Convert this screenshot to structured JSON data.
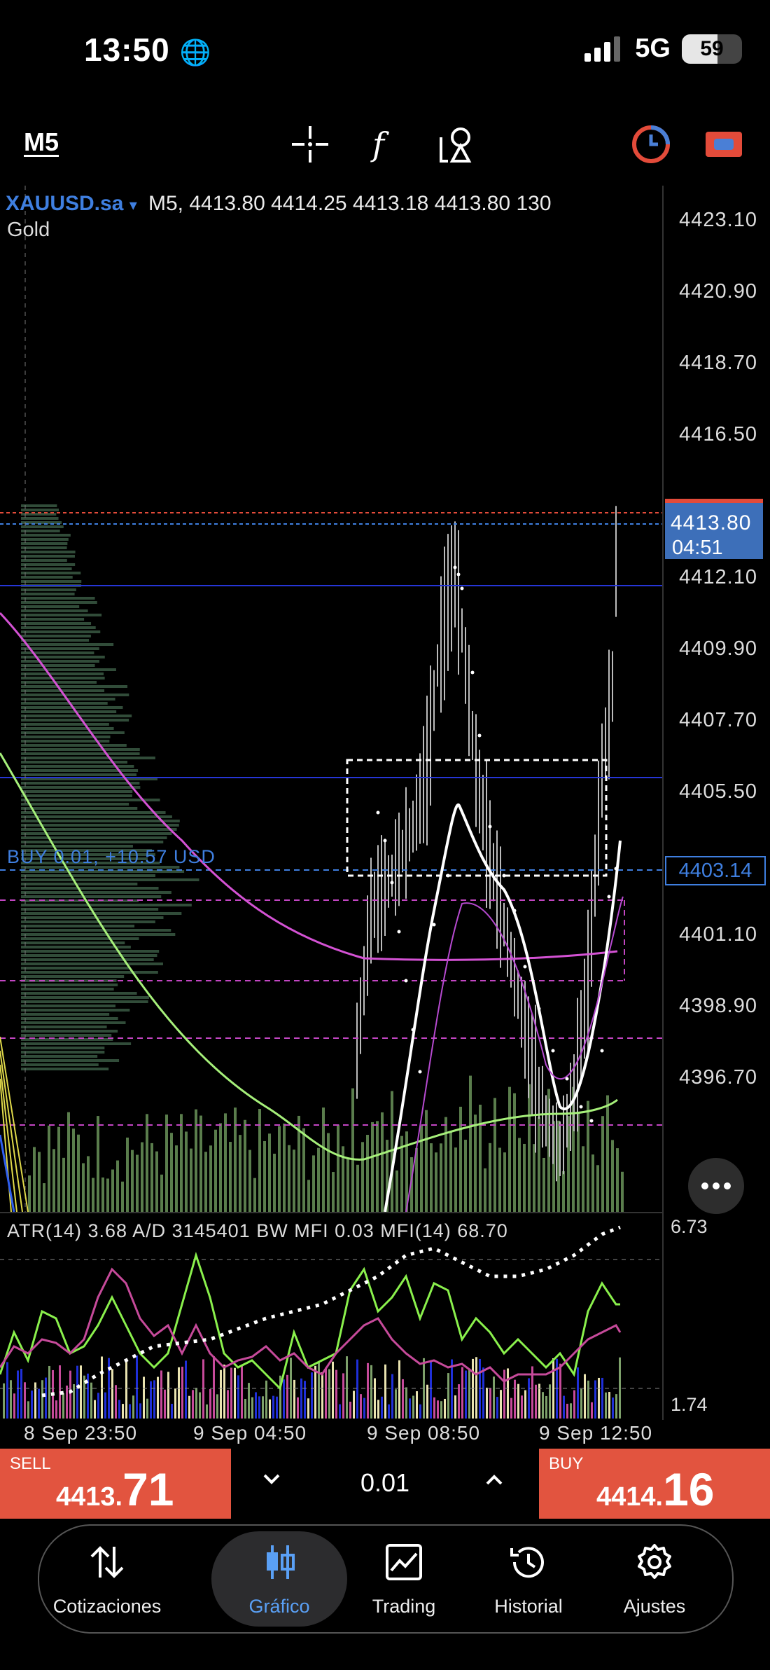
{
  "status_bar": {
    "time": "13:50",
    "network": "5G",
    "battery": "59"
  },
  "toolbar": {
    "timeframe": "M5",
    "tools": [
      "crosshair-icon",
      "function-icon",
      "objects-icon",
      "clock-icon",
      "trade-icon"
    ]
  },
  "chart": {
    "symbol": "XAUUSD.sa",
    "symbol_caret": "▾",
    "ohlc_line": "M5, 4413.80 4414.25 4413.18 4413.80 130",
    "symbol_name": "Gold",
    "price_ticks": [
      "4423.10",
      "4420.90",
      "4418.70",
      "4416.50",
      "4412.10",
      "4409.90",
      "4407.70",
      "4405.50",
      "4401.10",
      "4398.90",
      "4396.70"
    ],
    "current_price": "4413.80",
    "countdown": "04:51",
    "position_label": "BUY 0.01, +10.57 USD",
    "position_price": "4403.14",
    "indicator_label": "ATR(14)  3.68  A/D  3145401  BW MFI  0.03  MFI(14)  68.70",
    "indicator_max": "6.73",
    "indicator_min": "1.74",
    "time_axis": [
      "8 Sep 23:50",
      "9 Sep 04:50",
      "9 Sep 08:50",
      "9 Sep 12:50"
    ],
    "colors": {
      "bid_line": "#e34b3a",
      "ask_line": "#3f7fe0",
      "ma_fast": "#ffffff",
      "ma_mid": "#d452d4",
      "ma_slow": "#a6f07a",
      "volume": "#7da06a"
    }
  },
  "trade_bar": {
    "sell_label": "SELL",
    "sell_price_small": "4413.",
    "sell_price_big": "71",
    "lot": "0.01",
    "buy_label": "BUY",
    "buy_price_small": "4414.",
    "buy_price_big": "16"
  },
  "nav": {
    "items": [
      {
        "label": "Cotizaciones",
        "icon": "quotes-icon"
      },
      {
        "label": "Gráfico",
        "icon": "chart-icon"
      },
      {
        "label": "Trading",
        "icon": "trading-icon"
      },
      {
        "label": "Historial",
        "icon": "history-icon"
      },
      {
        "label": "Ajustes",
        "icon": "settings-icon"
      }
    ],
    "active": "Gráfico"
  }
}
